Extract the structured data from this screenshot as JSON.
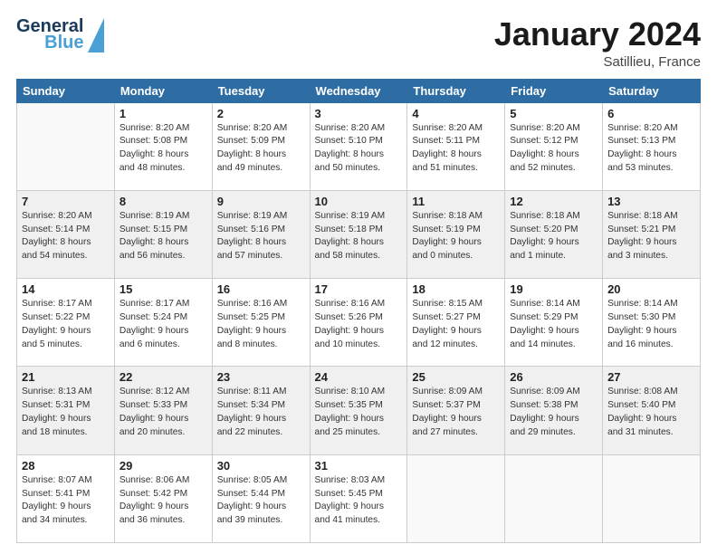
{
  "header": {
    "logo_line1": "General",
    "logo_line2": "Blue",
    "month": "January 2024",
    "location": "Satillieu, France"
  },
  "weekdays": [
    "Sunday",
    "Monday",
    "Tuesday",
    "Wednesday",
    "Thursday",
    "Friday",
    "Saturday"
  ],
  "weeks": [
    [
      {
        "day": "",
        "info": ""
      },
      {
        "day": "1",
        "info": "Sunrise: 8:20 AM\nSunset: 5:08 PM\nDaylight: 8 hours\nand 48 minutes."
      },
      {
        "day": "2",
        "info": "Sunrise: 8:20 AM\nSunset: 5:09 PM\nDaylight: 8 hours\nand 49 minutes."
      },
      {
        "day": "3",
        "info": "Sunrise: 8:20 AM\nSunset: 5:10 PM\nDaylight: 8 hours\nand 50 minutes."
      },
      {
        "day": "4",
        "info": "Sunrise: 8:20 AM\nSunset: 5:11 PM\nDaylight: 8 hours\nand 51 minutes."
      },
      {
        "day": "5",
        "info": "Sunrise: 8:20 AM\nSunset: 5:12 PM\nDaylight: 8 hours\nand 52 minutes."
      },
      {
        "day": "6",
        "info": "Sunrise: 8:20 AM\nSunset: 5:13 PM\nDaylight: 8 hours\nand 53 minutes."
      }
    ],
    [
      {
        "day": "7",
        "info": "Sunrise: 8:20 AM\nSunset: 5:14 PM\nDaylight: 8 hours\nand 54 minutes."
      },
      {
        "day": "8",
        "info": "Sunrise: 8:19 AM\nSunset: 5:15 PM\nDaylight: 8 hours\nand 56 minutes."
      },
      {
        "day": "9",
        "info": "Sunrise: 8:19 AM\nSunset: 5:16 PM\nDaylight: 8 hours\nand 57 minutes."
      },
      {
        "day": "10",
        "info": "Sunrise: 8:19 AM\nSunset: 5:18 PM\nDaylight: 8 hours\nand 58 minutes."
      },
      {
        "day": "11",
        "info": "Sunrise: 8:18 AM\nSunset: 5:19 PM\nDaylight: 9 hours\nand 0 minutes."
      },
      {
        "day": "12",
        "info": "Sunrise: 8:18 AM\nSunset: 5:20 PM\nDaylight: 9 hours\nand 1 minute."
      },
      {
        "day": "13",
        "info": "Sunrise: 8:18 AM\nSunset: 5:21 PM\nDaylight: 9 hours\nand 3 minutes."
      }
    ],
    [
      {
        "day": "14",
        "info": "Sunrise: 8:17 AM\nSunset: 5:22 PM\nDaylight: 9 hours\nand 5 minutes."
      },
      {
        "day": "15",
        "info": "Sunrise: 8:17 AM\nSunset: 5:24 PM\nDaylight: 9 hours\nand 6 minutes."
      },
      {
        "day": "16",
        "info": "Sunrise: 8:16 AM\nSunset: 5:25 PM\nDaylight: 9 hours\nand 8 minutes."
      },
      {
        "day": "17",
        "info": "Sunrise: 8:16 AM\nSunset: 5:26 PM\nDaylight: 9 hours\nand 10 minutes."
      },
      {
        "day": "18",
        "info": "Sunrise: 8:15 AM\nSunset: 5:27 PM\nDaylight: 9 hours\nand 12 minutes."
      },
      {
        "day": "19",
        "info": "Sunrise: 8:14 AM\nSunset: 5:29 PM\nDaylight: 9 hours\nand 14 minutes."
      },
      {
        "day": "20",
        "info": "Sunrise: 8:14 AM\nSunset: 5:30 PM\nDaylight: 9 hours\nand 16 minutes."
      }
    ],
    [
      {
        "day": "21",
        "info": "Sunrise: 8:13 AM\nSunset: 5:31 PM\nDaylight: 9 hours\nand 18 minutes."
      },
      {
        "day": "22",
        "info": "Sunrise: 8:12 AM\nSunset: 5:33 PM\nDaylight: 9 hours\nand 20 minutes."
      },
      {
        "day": "23",
        "info": "Sunrise: 8:11 AM\nSunset: 5:34 PM\nDaylight: 9 hours\nand 22 minutes."
      },
      {
        "day": "24",
        "info": "Sunrise: 8:10 AM\nSunset: 5:35 PM\nDaylight: 9 hours\nand 25 minutes."
      },
      {
        "day": "25",
        "info": "Sunrise: 8:09 AM\nSunset: 5:37 PM\nDaylight: 9 hours\nand 27 minutes."
      },
      {
        "day": "26",
        "info": "Sunrise: 8:09 AM\nSunset: 5:38 PM\nDaylight: 9 hours\nand 29 minutes."
      },
      {
        "day": "27",
        "info": "Sunrise: 8:08 AM\nSunset: 5:40 PM\nDaylight: 9 hours\nand 31 minutes."
      }
    ],
    [
      {
        "day": "28",
        "info": "Sunrise: 8:07 AM\nSunset: 5:41 PM\nDaylight: 9 hours\nand 34 minutes."
      },
      {
        "day": "29",
        "info": "Sunrise: 8:06 AM\nSunset: 5:42 PM\nDaylight: 9 hours\nand 36 minutes."
      },
      {
        "day": "30",
        "info": "Sunrise: 8:05 AM\nSunset: 5:44 PM\nDaylight: 9 hours\nand 39 minutes."
      },
      {
        "day": "31",
        "info": "Sunrise: 8:03 AM\nSunset: 5:45 PM\nDaylight: 9 hours\nand 41 minutes."
      },
      {
        "day": "",
        "info": ""
      },
      {
        "day": "",
        "info": ""
      },
      {
        "day": "",
        "info": ""
      }
    ]
  ]
}
